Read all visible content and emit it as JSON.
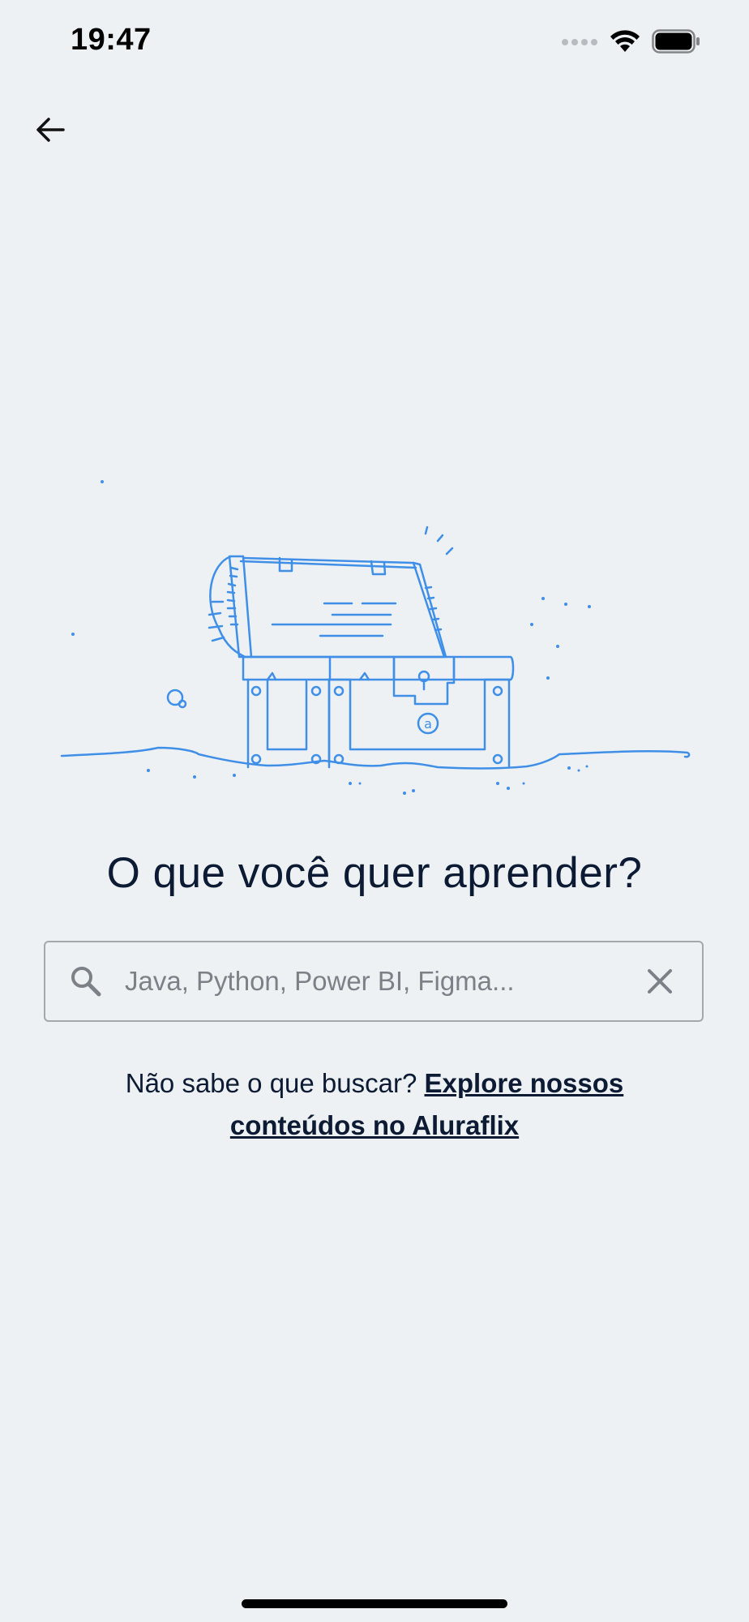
{
  "status_bar": {
    "time": "19:47",
    "icons": [
      "signal-dots-icon",
      "wifi-icon",
      "battery-icon"
    ]
  },
  "nav": {
    "back_icon": "arrow-left-icon"
  },
  "illustration": {
    "name": "treasure-chest-illustration",
    "color": "#3f8fe8"
  },
  "main": {
    "headline": "O que você quer aprender?",
    "search": {
      "placeholder": "Java, Python, Power BI, Figma...",
      "value": "",
      "leading_icon": "search-icon",
      "trailing_icon": "close-icon"
    },
    "helper": {
      "prefix": "Não sabe o que buscar? ",
      "link_label": "Explore nossos conteúdos no Aluraflix"
    }
  },
  "colors": {
    "background": "#edf1f3",
    "text": "#0c1b33",
    "accent_line": "#3f8fe8",
    "border": "#a3a8ad"
  }
}
